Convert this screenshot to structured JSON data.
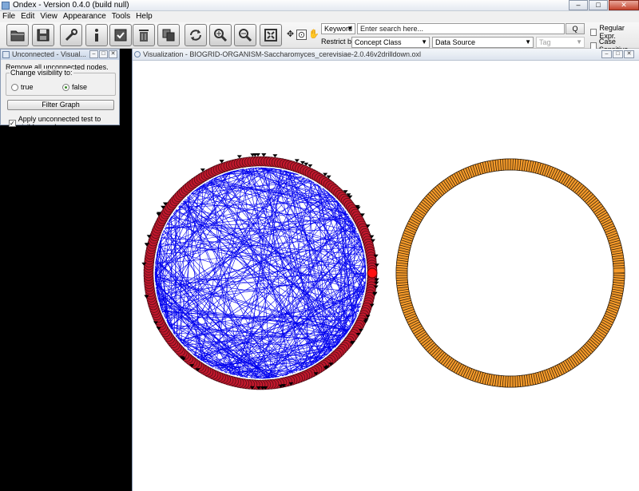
{
  "window": {
    "title": "Ondex - Version 0.4.0 (build null)",
    "minimize": "–",
    "maximize": "□",
    "close": "✕"
  },
  "menu": [
    "File",
    "Edit",
    "View",
    "Appearance",
    "Tools",
    "Help"
  ],
  "toolbar": {
    "icons": [
      "open-icon",
      "save-icon",
      "tools-icon",
      "info-icon",
      "checkbox-icon",
      "trash-icon",
      "copy-icon",
      "refresh-icon",
      "zoom-in-icon",
      "zoom-out-icon",
      "fit-icon",
      "move-icon",
      "select-icon",
      "hand-icon"
    ]
  },
  "search": {
    "mode": "Keyword",
    "placeholder": "Enter search here...",
    "go": "Q",
    "restrict_label": "Restrict by:",
    "concept_class": "Concept Class",
    "data_source": "Data Source",
    "tag": "Tag",
    "regex_label": "Regular Expr.",
    "case_label": "Case Sensitive"
  },
  "dialog": {
    "title": "Unconnected - Visual...",
    "description": "Remove all unconnected nodes.",
    "legend": "Change visibility to:",
    "option_true": "true",
    "option_false": "false",
    "selected": "false",
    "action": "Filter Graph",
    "apply_label": "Apply unconnected test to visible graph",
    "apply_checked": true
  },
  "visualization": {
    "title": "Visualization - BIOGRID-ORGANISM-Saccharomyces_cerevisiae-2.0.46v2drilldown.oxl",
    "colors": {
      "connected_nodes": "#c0182c",
      "edges": "#0000ee",
      "unconnected_nodes": "#f49a2a",
      "highlight": "#ff1010"
    }
  }
}
